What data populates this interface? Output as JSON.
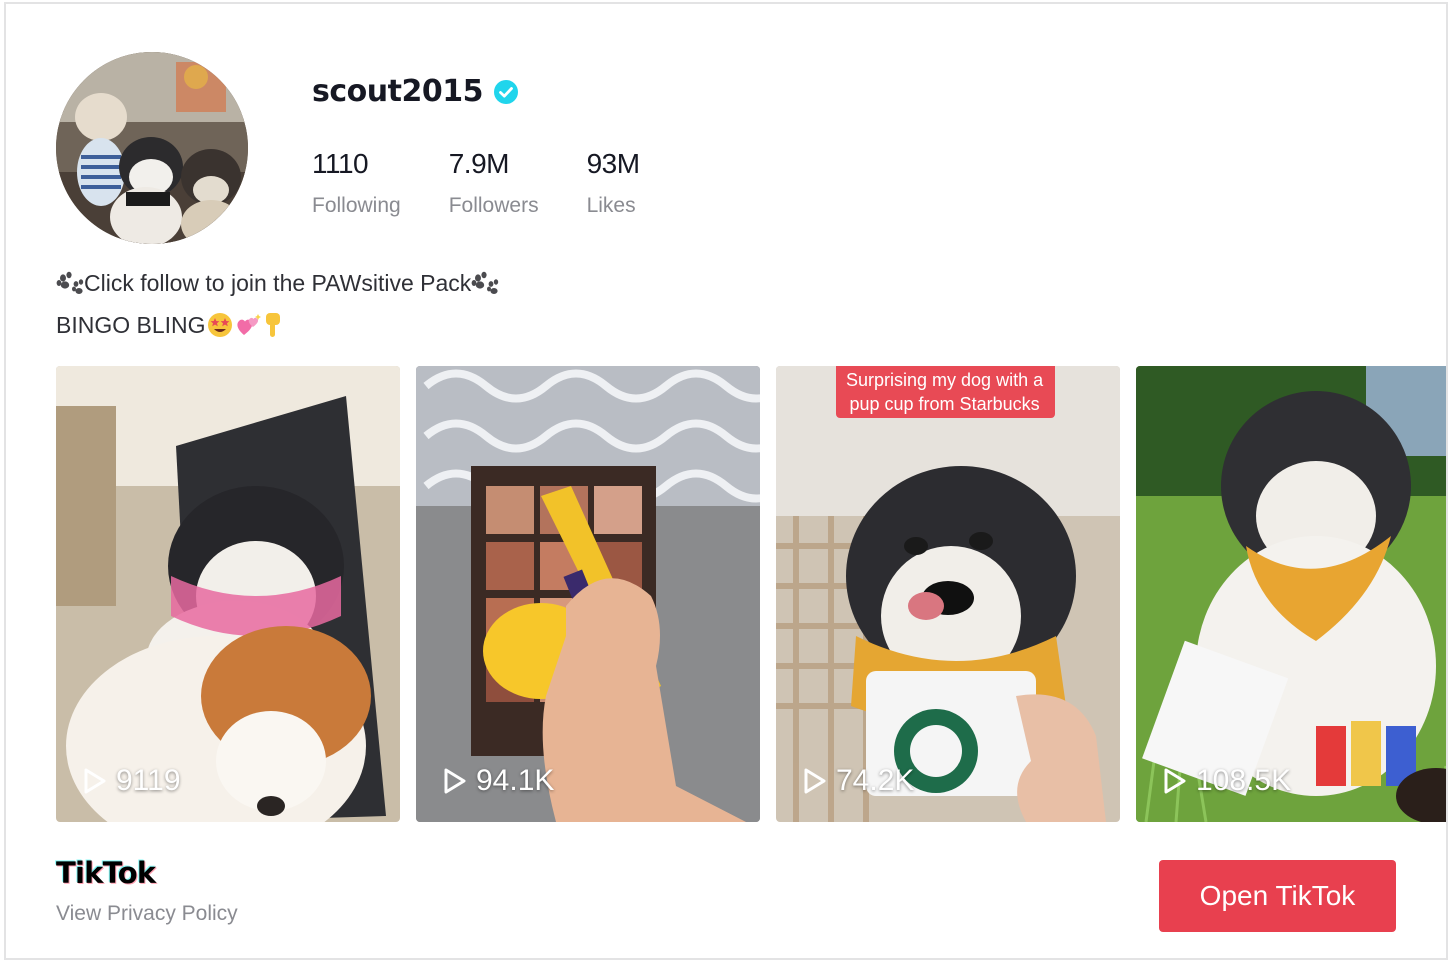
{
  "profile": {
    "username": "scout2015",
    "verified_icon": "verified-check-icon",
    "stats": [
      {
        "value": "1110",
        "label": "Following"
      },
      {
        "value": "7.9M",
        "label": "Followers"
      },
      {
        "value": "93M",
        "label": "Likes"
      }
    ],
    "bio": {
      "line1_text": "Click follow to join the PAWsitive Pack",
      "line2_text": "BINGO BLING",
      "line1_icons": [
        "paw-prints-icon",
        "paw-prints-icon"
      ],
      "line2_icons": [
        "star-struck-face-icon",
        "sparkling-hearts-icon",
        "pointing-down-icon"
      ]
    }
  },
  "videos": [
    {
      "views": "9119",
      "caption": ""
    },
    {
      "views": "94.1K",
      "caption": ""
    },
    {
      "views": "74.2K",
      "caption_line1": "Surprising my dog with a",
      "caption_line2": "pup cup from Starbucks"
    },
    {
      "views": "108.5K",
      "caption": ""
    }
  ],
  "footer": {
    "logo_text": "TikTok",
    "privacy_link": "View Privacy Policy",
    "open_button": "Open TikTok"
  },
  "colors": {
    "accent": "#e8404f",
    "verified": "#20d5ec",
    "muted_text": "#8a8b91"
  }
}
